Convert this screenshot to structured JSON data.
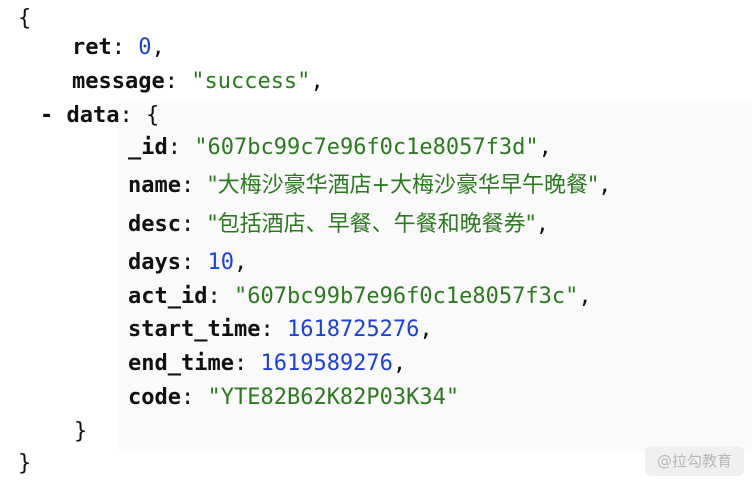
{
  "brackets": {
    "open": "{",
    "close": "}"
  },
  "toggle": "-",
  "json": {
    "ret": {
      "key": "ret",
      "value": "0"
    },
    "message": {
      "key": "message",
      "value": "\"success\""
    },
    "data": {
      "key": "data",
      "_id": {
        "key": "_id",
        "value": "\"607bc99c7e96f0c1e8057f3d\""
      },
      "name": {
        "key": "name",
        "value": "\"大梅沙豪华酒店+大梅沙豪华早午晚餐\""
      },
      "desc": {
        "key": "desc",
        "value": "\"包括酒店、早餐、午餐和晚餐券\""
      },
      "days": {
        "key": "days",
        "value": "10"
      },
      "act_id": {
        "key": "act_id",
        "value": "\"607bc99b7e96f0c1e8057f3c\""
      },
      "start_time": {
        "key": "start_time",
        "value": "1618725276"
      },
      "end_time": {
        "key": "end_time",
        "value": "1619589276"
      },
      "code": {
        "key": "code",
        "value": "\"YTE82B62K82P03K34\""
      }
    }
  },
  "punctuation": {
    "colon": ": ",
    "comma": ","
  },
  "watermark": "@拉勾教育",
  "colors": {
    "string": "#2c7a1f",
    "number": "#1c3fe0",
    "key": "#111111",
    "panel_bg": "#fafafa"
  }
}
